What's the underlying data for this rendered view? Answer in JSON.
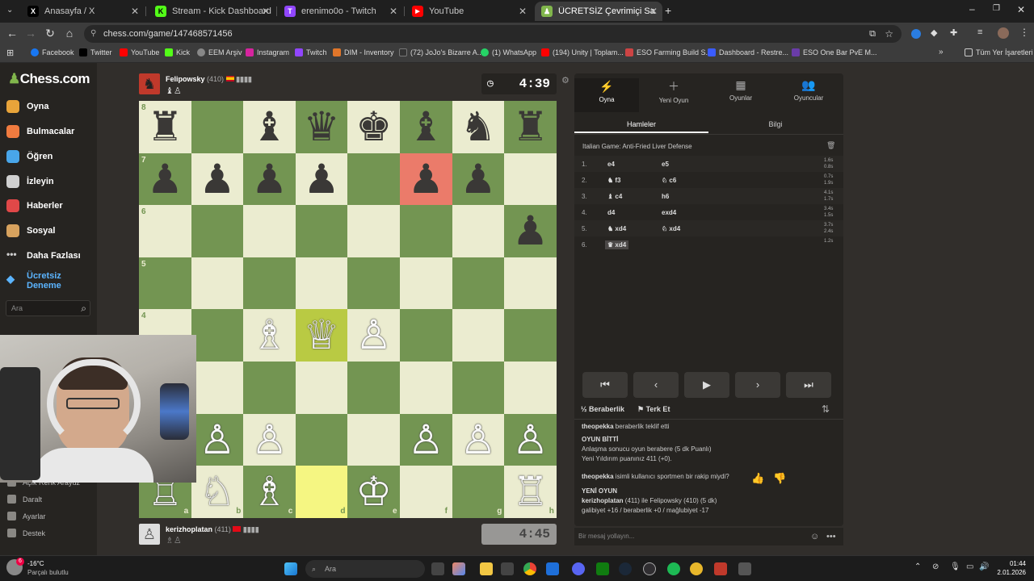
{
  "tabs": [
    {
      "title": "Anasayfa / X",
      "color": "#000000",
      "glyph": "X"
    },
    {
      "title": "Stream - Kick Dashboard",
      "color": "#53fc18",
      "glyph": "K"
    },
    {
      "title": "erenimo0o - Twitch",
      "color": "#9146ff",
      "glyph": "T"
    },
    {
      "title": "YouTube",
      "color": "#ff0000",
      "glyph": "▶"
    },
    {
      "title": "ÜCRETSİZ Çevrimiçi Satranç Oy",
      "color": "#81b64c",
      "glyph": "♟"
    }
  ],
  "url": "chess.com/game/147468571456",
  "bookmarks": [
    "Facebook",
    "Twitter",
    "YouTube",
    "Kick",
    "EEM Arşiv",
    "Instagram",
    "Twitch",
    "DIM - Inventory",
    "(72) JoJo's Bizarre A...",
    "(1) WhatsApp",
    "(194) Unity | Toplam...",
    "ESO Farming Build S...",
    "Dashboard - Restre...",
    "ESO One Bar PvE M...",
    "Tüm Yer İşaretleri"
  ],
  "sidebar": {
    "logo": "Chess.com",
    "items": [
      "Oyna",
      "Bulmacalar",
      "Öğren",
      "İzleyin",
      "Haberler",
      "Sosyal",
      "Daha Fazlası"
    ],
    "trial": [
      "Ücretsiz",
      "Deneme"
    ],
    "search_placeholder": "Ara",
    "bottom": [
      "Açık Renk Arayüz",
      "Daralt",
      "Ayarlar",
      "Destek"
    ]
  },
  "top_player": {
    "name": "Felipowsky",
    "rating": "(410)",
    "clock": "4:39",
    "captured": "♝♙"
  },
  "bottom_player": {
    "name": "kerizhoplatan",
    "rating": "(411)",
    "clock": "4:45",
    "captured": "♗♙"
  },
  "board": {
    "ranks": [
      "8",
      "7",
      "6",
      "5",
      "4"
    ],
    "files": [
      "a",
      "b",
      "c",
      "d",
      "e",
      "f",
      "g",
      "h"
    ],
    "highlight_colors": {
      "last_move": "#f5f682",
      "check": "#eb7b6a"
    },
    "pieces": [
      {
        "sq": "a8",
        "p": "♜"
      },
      {
        "sq": "c8",
        "p": "♝"
      },
      {
        "sq": "d8",
        "p": "♛"
      },
      {
        "sq": "e8",
        "p": "♚"
      },
      {
        "sq": "f8",
        "p": "♝"
      },
      {
        "sq": "g8",
        "p": "♞"
      },
      {
        "sq": "h8",
        "p": "♜"
      },
      {
        "sq": "a7",
        "p": "♟"
      },
      {
        "sq": "b7",
        "p": "♟"
      },
      {
        "sq": "c7",
        "p": "♟"
      },
      {
        "sq": "d7",
        "p": "♟"
      },
      {
        "sq": "f7",
        "p": "♟"
      },
      {
        "sq": "g7",
        "p": "♟"
      },
      {
        "sq": "h6",
        "p": "♟"
      },
      {
        "sq": "c4",
        "p": "♗"
      },
      {
        "sq": "d4",
        "p": "♕"
      },
      {
        "sq": "e4",
        "p": "♙"
      },
      {
        "sq": "b2",
        "p": "♙"
      },
      {
        "sq": "c2",
        "p": "♙"
      },
      {
        "sq": "f2",
        "p": "♙"
      },
      {
        "sq": "g2",
        "p": "♙"
      },
      {
        "sq": "h2",
        "p": "♙"
      },
      {
        "sq": "a1",
        "p": "♖"
      },
      {
        "sq": "b1",
        "p": "♘"
      },
      {
        "sq": "c1",
        "p": "♗"
      },
      {
        "sq": "e1",
        "p": "♔"
      },
      {
        "sq": "h1",
        "p": "♖"
      }
    ]
  },
  "panel": {
    "tabs": [
      {
        "label": "Oyna",
        "icon": "⚡"
      },
      {
        "label": "Yeni Oyun",
        "icon": "＋"
      },
      {
        "label": "Oyunlar",
        "icon": "▦"
      },
      {
        "label": "Oyuncular",
        "icon": "👥"
      }
    ],
    "subtabs": [
      "Hamleler",
      "Bilgi"
    ],
    "opening": "Italian Game: Anti-Fried Liver Defense",
    "moves": [
      {
        "n": "1.",
        "w": "e4",
        "b": "e5",
        "t": "1.6s\n0.8s"
      },
      {
        "n": "2.",
        "w": "♞ f3",
        "b": "♘ c6",
        "t": "0.7s\n1.9s"
      },
      {
        "n": "3.",
        "w": "♝ c4",
        "b": "h6",
        "t": "4.1s\n1.7s"
      },
      {
        "n": "4.",
        "w": "d4",
        "b": "exd4",
        "t": "3.4s\n1.5s"
      },
      {
        "n": "5.",
        "w": "♞ xd4",
        "b": "♘ xd4",
        "t": "3.7s\n2.4s"
      },
      {
        "n": "6.",
        "w": "♛ xd4",
        "b": "",
        "t": "1.2s"
      }
    ],
    "controls": [
      "⏮",
      "‹",
      "▶",
      "›",
      "⏭"
    ],
    "draw": "Beraberlik",
    "resign": "Terk Et"
  },
  "chat": [
    {
      "bold": "theopekka",
      "text": " beraberlik teklif etti"
    },
    {
      "bold": "OYUN BİTTİ",
      "text": ""
    },
    {
      "bold": "",
      "text": "Anlaşma sonucu oyun berabere (5 dk Puanlı)"
    },
    {
      "bold": "",
      "text": "Yeni Yıldırım puanınız 411 (+0)."
    },
    {
      "bold": "theopekka",
      "text": " isimli kullanıcı sportmen bir rakip miydi?"
    },
    {
      "bold": "YENİ OYUN",
      "text": ""
    },
    {
      "bold": "kerizhoplatan",
      "text": " (411) ile Felipowsky (410) (5 dk)"
    },
    {
      "bold": "",
      "text": "galibiyet +16 / beraberlik +0 / mağlubiyet -17"
    }
  ],
  "chat_placeholder": "Bir mesaj yollayın...",
  "taskbar": {
    "weather_temp": "-16°C",
    "weather_text": "Parçalı bulutlu",
    "search": "Ara",
    "time": "01:44",
    "date": "2.01.2026"
  }
}
